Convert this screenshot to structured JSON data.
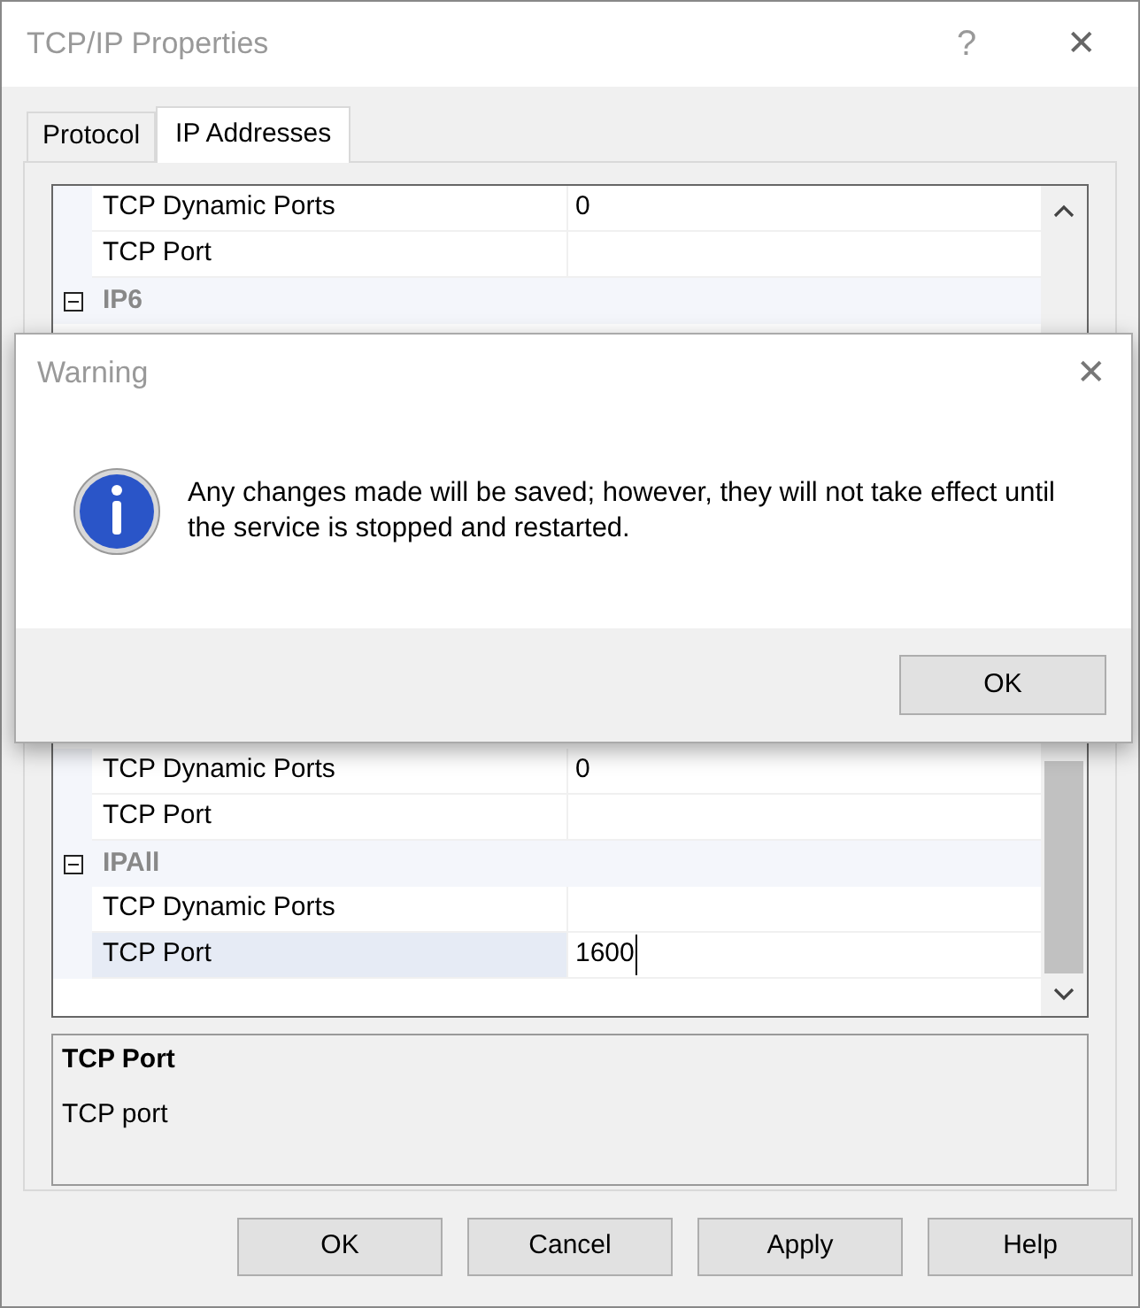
{
  "window": {
    "title": "TCP/IP Properties",
    "help_glyph": "?",
    "close_glyph": "✕"
  },
  "tabs": [
    {
      "label": "Protocol",
      "selected": false
    },
    {
      "label": "IP Addresses",
      "selected": true
    }
  ],
  "grid_top": [
    {
      "kind": "property",
      "label": "TCP Dynamic Ports",
      "value": "0",
      "selected": false
    },
    {
      "kind": "property",
      "label": "TCP Port",
      "selected": false
    },
    {
      "kind": "group",
      "label": "IP6",
      "expanded": true,
      "selected": false
    }
  ],
  "grid_bottom": [
    {
      "kind": "property",
      "label": "TCP Dynamic Ports",
      "value": "0",
      "selected": false
    },
    {
      "kind": "property",
      "label": "TCP Port",
      "selected": false
    },
    {
      "kind": "group",
      "label": "IPAll",
      "expanded": true,
      "selected": false
    },
    {
      "kind": "property",
      "label": "TCP Dynamic Ports",
      "selected": false
    },
    {
      "kind": "property",
      "label": "TCP Port",
      "value": "1600",
      "selected": true
    }
  ],
  "description": {
    "title": "TCP Port",
    "text": "TCP port"
  },
  "buttons": [
    "OK",
    "Cancel",
    "Apply",
    "Help"
  ],
  "warning": {
    "title": "Warning",
    "close_glyph": "✕",
    "message": "Any changes made will be saved; however, they will not take effect until the service is stopped and restarted.",
    "button": "OK"
  }
}
